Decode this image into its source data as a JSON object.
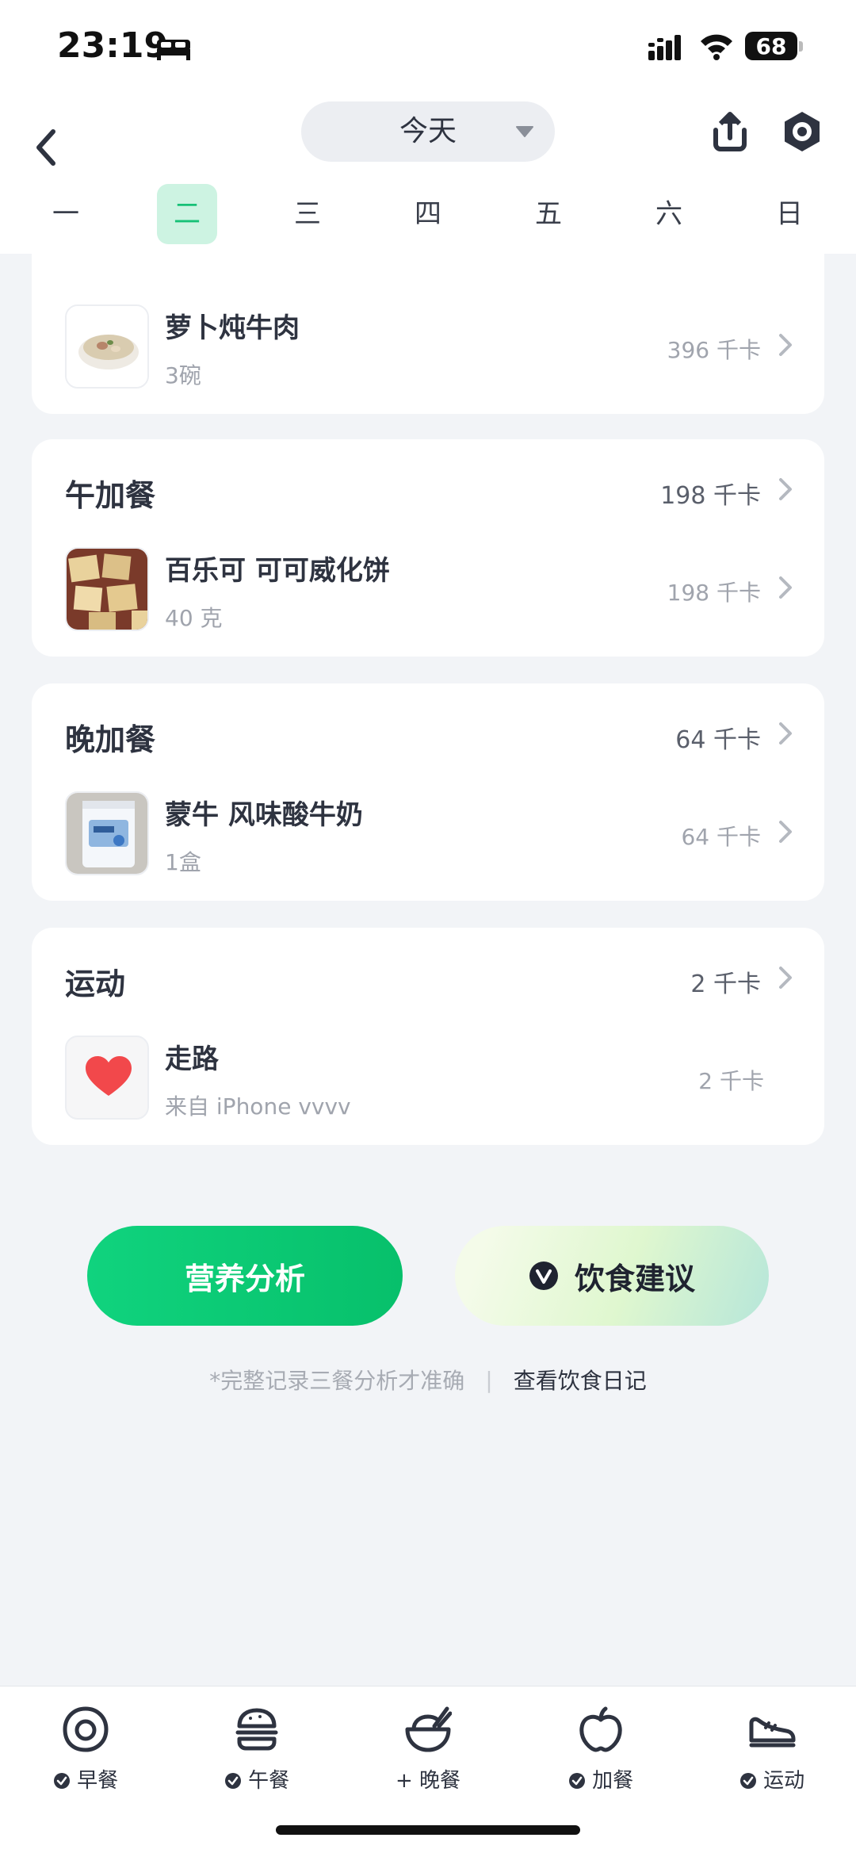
{
  "status_bar": {
    "time": "23:19",
    "battery": "68"
  },
  "header": {
    "date_selector": "今天",
    "weekdays": [
      "一",
      "二",
      "三",
      "四",
      "五",
      "六",
      "日"
    ],
    "active_weekday": "二"
  },
  "meals": {
    "top_item": {
      "name": "萝卜炖牛肉",
      "amount": "3碗",
      "kcal": "396 千卡"
    },
    "afternoon_snack": {
      "title": "午加餐",
      "kcal": "198 千卡",
      "item": {
        "name": "百乐可 可可威化饼",
        "amount": "40 克",
        "kcal": "198 千卡"
      }
    },
    "evening_snack": {
      "title": "晚加餐",
      "kcal": "64 千卡",
      "item": {
        "name": "蒙牛 风味酸牛奶",
        "amount": "1盒",
        "kcal": "64 千卡"
      }
    },
    "exercise": {
      "title": "运动",
      "kcal": "2 千卡",
      "item": {
        "name": "走路",
        "amount": "来自 iPhone vvvv",
        "kcal": "2 千卡"
      }
    }
  },
  "actions": {
    "nutrition_label": "营养分析",
    "advice_label": "饮食建议",
    "hint": "*完整记录三餐分析才准确",
    "diary_link": "查看饮食日记"
  },
  "tabbar": [
    {
      "icon": "egg-icon",
      "label": "早餐",
      "prefix": "check"
    },
    {
      "icon": "burger-icon",
      "label": "午餐",
      "prefix": "check"
    },
    {
      "icon": "rice-bowl-icon",
      "label": "晚餐",
      "prefix": "+"
    },
    {
      "icon": "apple-icon",
      "label": "加餐",
      "prefix": "check"
    },
    {
      "icon": "sneaker-icon",
      "label": "运动",
      "prefix": "check"
    }
  ],
  "colors": {
    "accent": "#17c177",
    "background": "#f2f4f7",
    "heart": "#f2484b"
  }
}
